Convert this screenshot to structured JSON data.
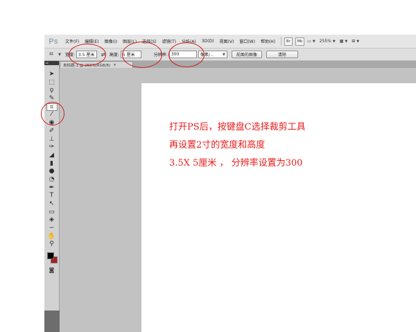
{
  "app": {
    "logo": "Ps",
    "menus": [
      "文件(F)",
      "编辑(E)",
      "图像(I)",
      "图层(L)",
      "选择(S)",
      "滤镜(T)",
      "分析(A)",
      "3D(D)",
      "视图(V)",
      "窗口(W)",
      "帮助(H)"
    ],
    "bridge_button": "Br",
    "mini_bridge_button": "Mb",
    "zoom": "255%"
  },
  "options": {
    "width_label": "宽度:",
    "width_value": "3.5 厘米",
    "height_label": "高度:",
    "height_value": "5 厘米",
    "resolution_label": "分辨率:",
    "resolution_value": "300",
    "unit_select": "像素/...",
    "front_image_button": "前面的图像",
    "clear_button": "清除"
  },
  "document": {
    "tab_title": "未标题-1 @ 255%(RGB/8)",
    "close_glyph": "×"
  },
  "annotation": {
    "line1": "打开PS后，按键盘C选择裁剪工具",
    "line2": "再设置2寸的宽度和高度",
    "line3": "3.5X 5厘米 ， 分辨率设置为300",
    "color": "#e81d1d"
  },
  "colors": {
    "foreground": "#000000",
    "background": "#b01c1c",
    "highlight_circle": "#d11a1a"
  }
}
